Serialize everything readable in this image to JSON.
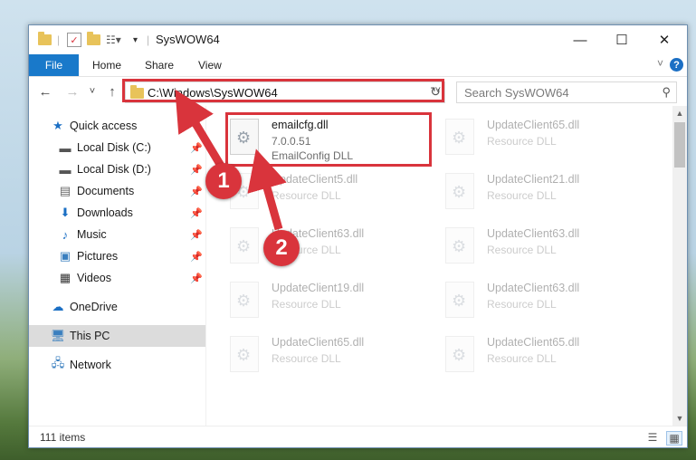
{
  "window": {
    "title": "SysWOW64"
  },
  "ribbon": {
    "file": "File",
    "tabs": [
      "Home",
      "Share",
      "View"
    ],
    "help": "?"
  },
  "nav": {
    "back": "←",
    "forward": "→",
    "recent": "˅",
    "up": "↑",
    "address": "C:\\Windows\\SysWOW64",
    "search_placeholder": "Search SysWOW64"
  },
  "sidebar": {
    "items": [
      {
        "label": "Quick access",
        "icon": "star-icon"
      },
      {
        "label": "Local Disk (C:)",
        "icon": "drive-icon"
      },
      {
        "label": "Local Disk (D:)",
        "icon": "drive-icon"
      },
      {
        "label": "Documents",
        "icon": "documents-icon"
      },
      {
        "label": "Downloads",
        "icon": "download-icon"
      },
      {
        "label": "Music",
        "icon": "music-icon"
      },
      {
        "label": "Pictures",
        "icon": "pictures-icon"
      },
      {
        "label": "Videos",
        "icon": "videos-icon"
      },
      {
        "label": "OneDrive",
        "icon": "cloud-icon"
      },
      {
        "label": "This PC",
        "icon": "computer-icon"
      },
      {
        "label": "Network",
        "icon": "network-icon"
      }
    ]
  },
  "files": [
    {
      "name": "emailcfg.dll",
      "version": "7.0.0.51",
      "desc": "EmailConfig DLL"
    },
    {
      "name": "UpdateClient65.dll",
      "desc": "Resource DLL"
    },
    {
      "name": "UpdateClient5.dll",
      "desc": "Resource DLL"
    },
    {
      "name": "UpdateClient21.dll",
      "desc": "Resource DLL"
    },
    {
      "name": "UpdateClient63.dll",
      "desc": "Resource DLL"
    },
    {
      "name": "UpdateClient63.dll",
      "desc": "Resource DLL"
    },
    {
      "name": "UpdateClient19.dll",
      "desc": "Resource DLL"
    },
    {
      "name": "UpdateClient63.dll",
      "desc": "Resource DLL"
    },
    {
      "name": "UpdateClient65.dll",
      "desc": "Resource DLL"
    },
    {
      "name": "UpdateClient65.dll",
      "desc": "Resource DLL"
    }
  ],
  "status": {
    "items": "111 items"
  },
  "annotations": {
    "step1": "1",
    "step2": "2"
  },
  "colors": {
    "accent": "#1979ca",
    "highlight": "#d9343c"
  }
}
